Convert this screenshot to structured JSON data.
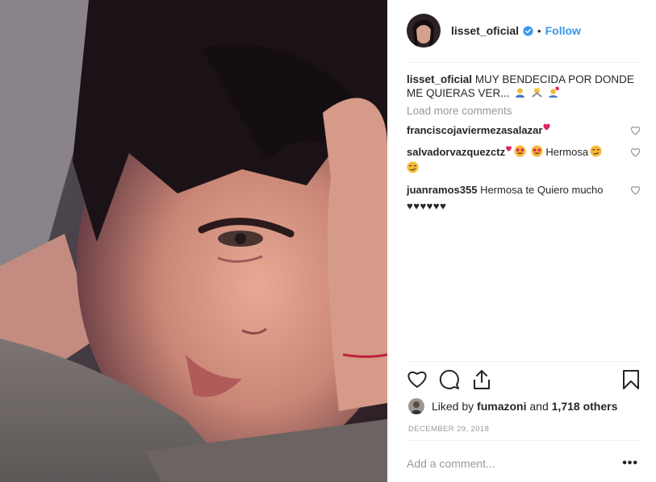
{
  "post": {
    "image_description_icon": "selfie-photo",
    "author": {
      "username": "lisset_oficial",
      "verified": true,
      "follow_label": "Follow",
      "separator": "•"
    },
    "caption": {
      "username": "lisset_oficial",
      "text": "MUY BENDECIDA POR DONDE ME QUIERAS VER..."
    },
    "load_more_label": "Load more comments",
    "comments": [
      {
        "username": "franciscojaviermezasalazar",
        "text": ""
      },
      {
        "username": "salvadorvazquezctz",
        "text": "Hermosa"
      },
      {
        "username": "juanramos355",
        "text": "Hermosa te Quiero mucho",
        "line2": "♥♥♥♥♥♥"
      }
    ],
    "likes": {
      "prefix": "Liked by",
      "user": "fumazoni",
      "middle": "and",
      "count": "1,718 others"
    },
    "date": "DECEMBER 29, 2018",
    "add_comment_placeholder": "Add a comment...",
    "more_label": "•••",
    "colors": {
      "link": "#3897f0",
      "muted": "#999999",
      "text": "#262626"
    }
  }
}
